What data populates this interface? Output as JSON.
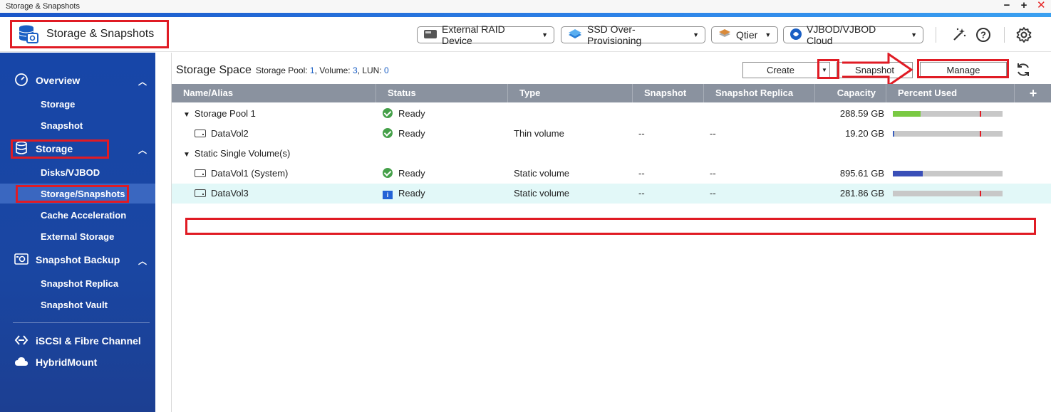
{
  "window": {
    "title": "Storage & Snapshots",
    "controls": [
      "−",
      "+",
      "✕"
    ]
  },
  "header": {
    "app_title": "Storage & Snapshots",
    "buttons": {
      "external_raid": "External RAID Device",
      "ssd_overprovisioning": "SSD Over-Provisioning",
      "qtier": "Qtier",
      "vjbod": "VJBOD/VJBOD Cloud"
    }
  },
  "sidebar": {
    "overview": "Overview",
    "overview_items": [
      "Storage",
      "Snapshot"
    ],
    "storage": "Storage",
    "storage_items": [
      "Disks/VJBOD",
      "Storage/Snapshots",
      "Cache Acceleration",
      "External Storage"
    ],
    "snapshot_backup": "Snapshot Backup",
    "snapshot_backup_items": [
      "Snapshot Replica",
      "Snapshot Vault"
    ],
    "iscsi": "iSCSI & Fibre Channel",
    "hybridmount": "HybridMount"
  },
  "main": {
    "title": "Storage Space",
    "meta_pool_label": "Storage Pool:",
    "meta_pool": "1",
    "meta_volume_label": ", Volume:",
    "meta_volume": "3",
    "meta_lun_label": ", LUN:",
    "meta_lun": "0",
    "actions": {
      "create": "Create",
      "snapshot": "Snapshot",
      "manage": "Manage"
    }
  },
  "table": {
    "columns": [
      "Name/Alias",
      "Status",
      "Type",
      "Snapshot",
      "Snapshot Replica",
      "Capacity",
      "Percent Used"
    ],
    "rows": [
      {
        "name": "Storage Pool 1",
        "status": "Ready",
        "type": "",
        "snapshot": "",
        "replica": "",
        "capacity": "288.59 GB",
        "used": 0.25,
        "color": "#7ac943"
      },
      {
        "name": "DataVol2",
        "status": "Ready",
        "type": "Thin volume",
        "snapshot": "--",
        "replica": "--",
        "capacity": "19.20 GB",
        "used": 0.01,
        "color": "#3a5fc0"
      },
      {
        "name": "Static Single Volume(s)",
        "status": "",
        "type": "",
        "snapshot": "",
        "replica": "",
        "capacity": "",
        "used": null,
        "color": ""
      },
      {
        "name": "DataVol1 (System)",
        "status": "Ready",
        "type": "Static volume",
        "snapshot": "--",
        "replica": "--",
        "capacity": "895.61 GB",
        "used": 0.27,
        "color": "#3a4fb8"
      },
      {
        "name": "DataVol3",
        "status": "Ready",
        "type": "Static volume",
        "snapshot": "--",
        "replica": "--",
        "capacity": "281.86 GB",
        "used": 0.0,
        "color": "#3a5fc0"
      }
    ]
  },
  "colors": {
    "sidebar_bg": "#1746a8",
    "highlight_red": "#e01b24",
    "selected_row": "#e2f8f8",
    "table_header": "#8a929f"
  }
}
